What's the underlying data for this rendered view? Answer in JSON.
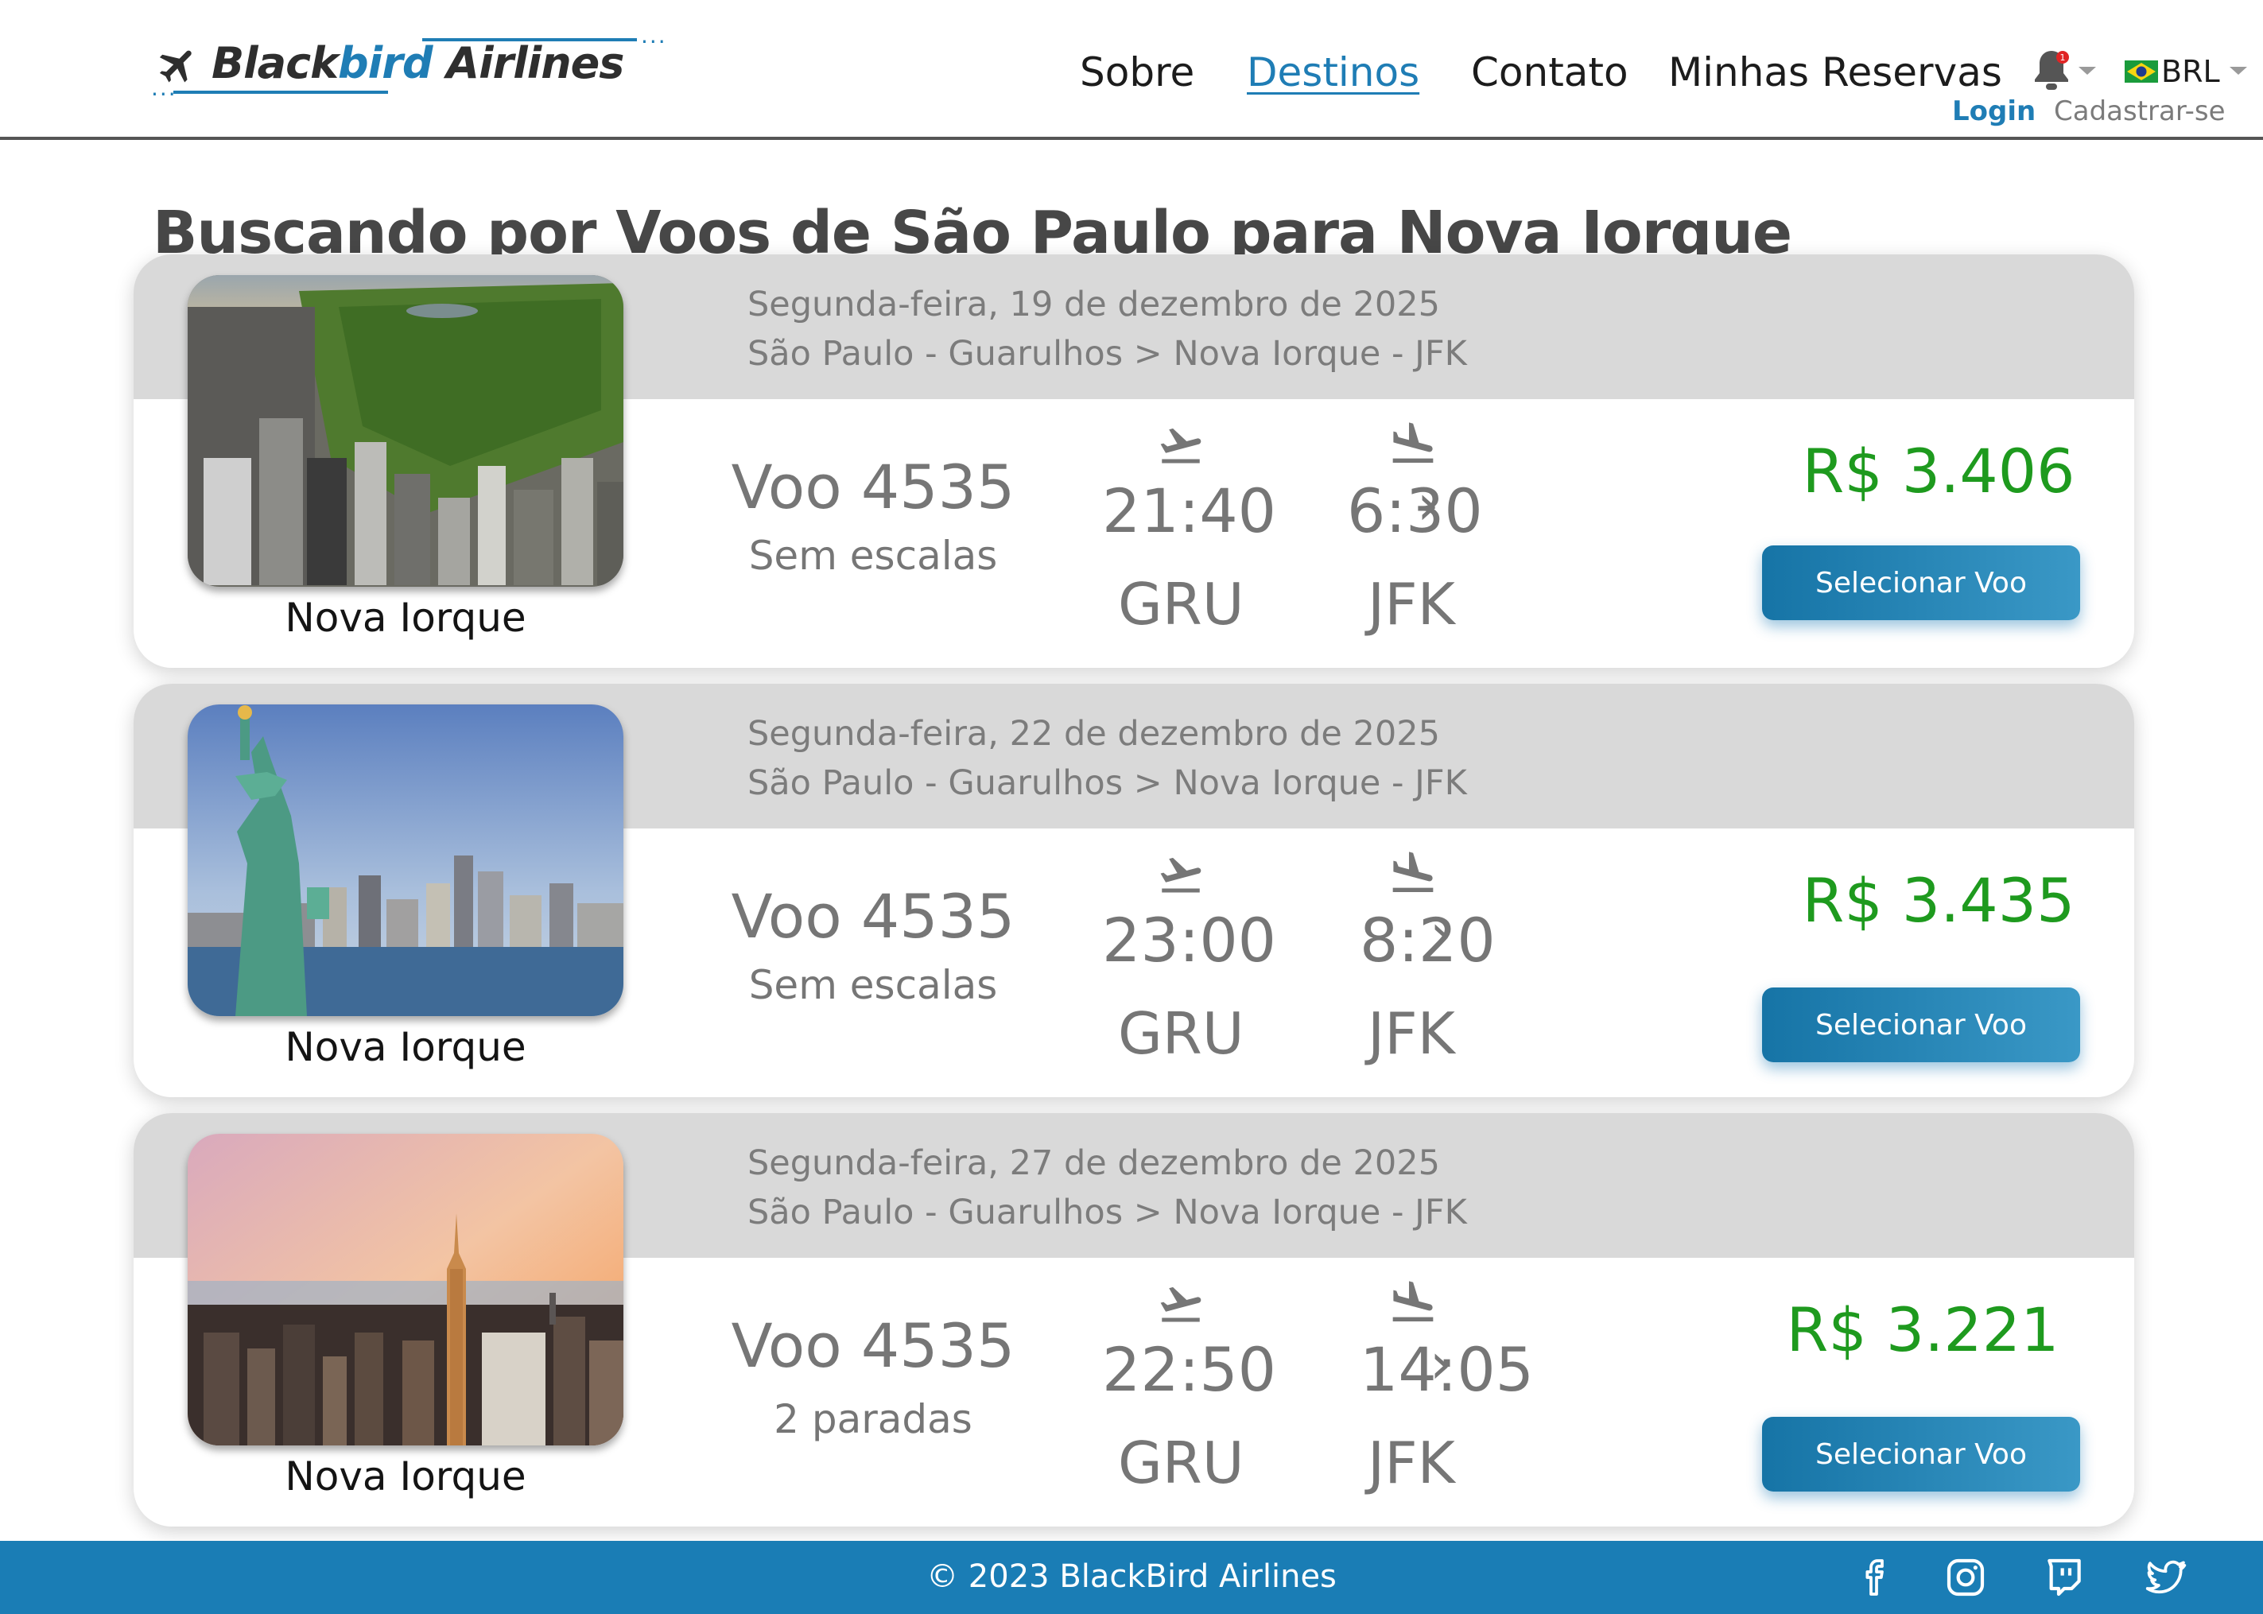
{
  "header": {
    "logo": {
      "part1": "Black",
      "part2": "bird",
      "part3": " Airlines"
    },
    "nav": [
      {
        "label": "Sobre"
      },
      {
        "label": "Destinos"
      },
      {
        "label": "Contato"
      },
      {
        "label": "Minhas Reservas"
      }
    ],
    "notification_count": "1",
    "currency": "BRL",
    "login_label": "Login",
    "signup_label": "Cadastrar-se"
  },
  "page_title": "Buscando por Voos de São Paulo para Nova Iorque",
  "flights": [
    {
      "date": "Segunda-feira, 19 de dezembro de 2025",
      "route": "São Paulo - Guarulhos > Nova Iorque - JFK",
      "city": "Nova Iorque",
      "flight": "Voo 4535",
      "stops": "Sem escalas",
      "dep_time": "21:40",
      "arr_time": "6:30",
      "sep": "›",
      "origin": "GRU",
      "destination": "JFK",
      "price": "R$ 3.406",
      "button_label": "Selecionar Voo"
    },
    {
      "date": "Segunda-feira, 22 de dezembro de 2025",
      "route": "São Paulo - Guarulhos > Nova Iorque - JFK",
      "city": "Nova Iorque",
      "flight": "Voo 4535",
      "stops": "Sem escalas",
      "dep_time": "23:00",
      "arr_time": "8:20",
      "sep": "›",
      "origin": "GRU",
      "destination": "JFK",
      "price": "R$ 3.435",
      "button_label": "Selecionar Voo"
    },
    {
      "date": "Segunda-feira, 27 de dezembro de 2025",
      "route": "São Paulo - Guarulhos > Nova Iorque - JFK",
      "city": "Nova Iorque",
      "flight": "Voo 4535",
      "stops": "2 paradas",
      "dep_time": "22:50",
      "arr_time": "14:05",
      "sep": "›",
      "origin": "GRU",
      "destination": "JFK",
      "price": "R$ 3.221",
      "button_label": "Selecionar Voo"
    }
  ],
  "footer": {
    "copyright": "© 2023 BlackBird Airlines",
    "social": [
      "facebook-icon",
      "instagram-icon",
      "twitch-icon",
      "twitter-icon"
    ]
  },
  "colors": {
    "accent": "#1f7db5",
    "price": "#1e9a1e",
    "band": "#d9d9d9",
    "text": "#474747"
  }
}
